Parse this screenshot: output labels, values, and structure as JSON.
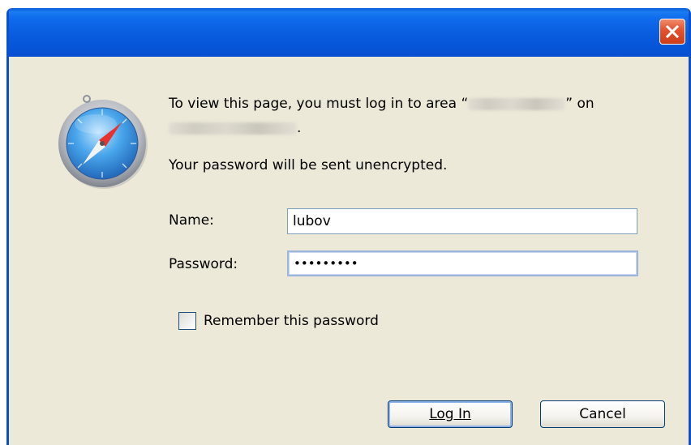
{
  "window": {
    "close_label": "Close",
    "colors": {
      "titlebar": "#0a5ee0",
      "body": "#ece9d8",
      "close": "#e1522d"
    }
  },
  "dialog": {
    "icon": "safari-compass-icon",
    "message_prefix": "To view this page, you must log in to area “",
    "message_middle": "” on",
    "message_end": ".",
    "warning": "Your password will be sent unencrypted."
  },
  "form": {
    "name_label": "Name:",
    "name_value": "lubov",
    "password_label": "Password:",
    "password_value": "•••••••••",
    "remember_label": "Remember this password",
    "remember_checked": false
  },
  "buttons": {
    "login": "Log In",
    "cancel": "Cancel"
  }
}
